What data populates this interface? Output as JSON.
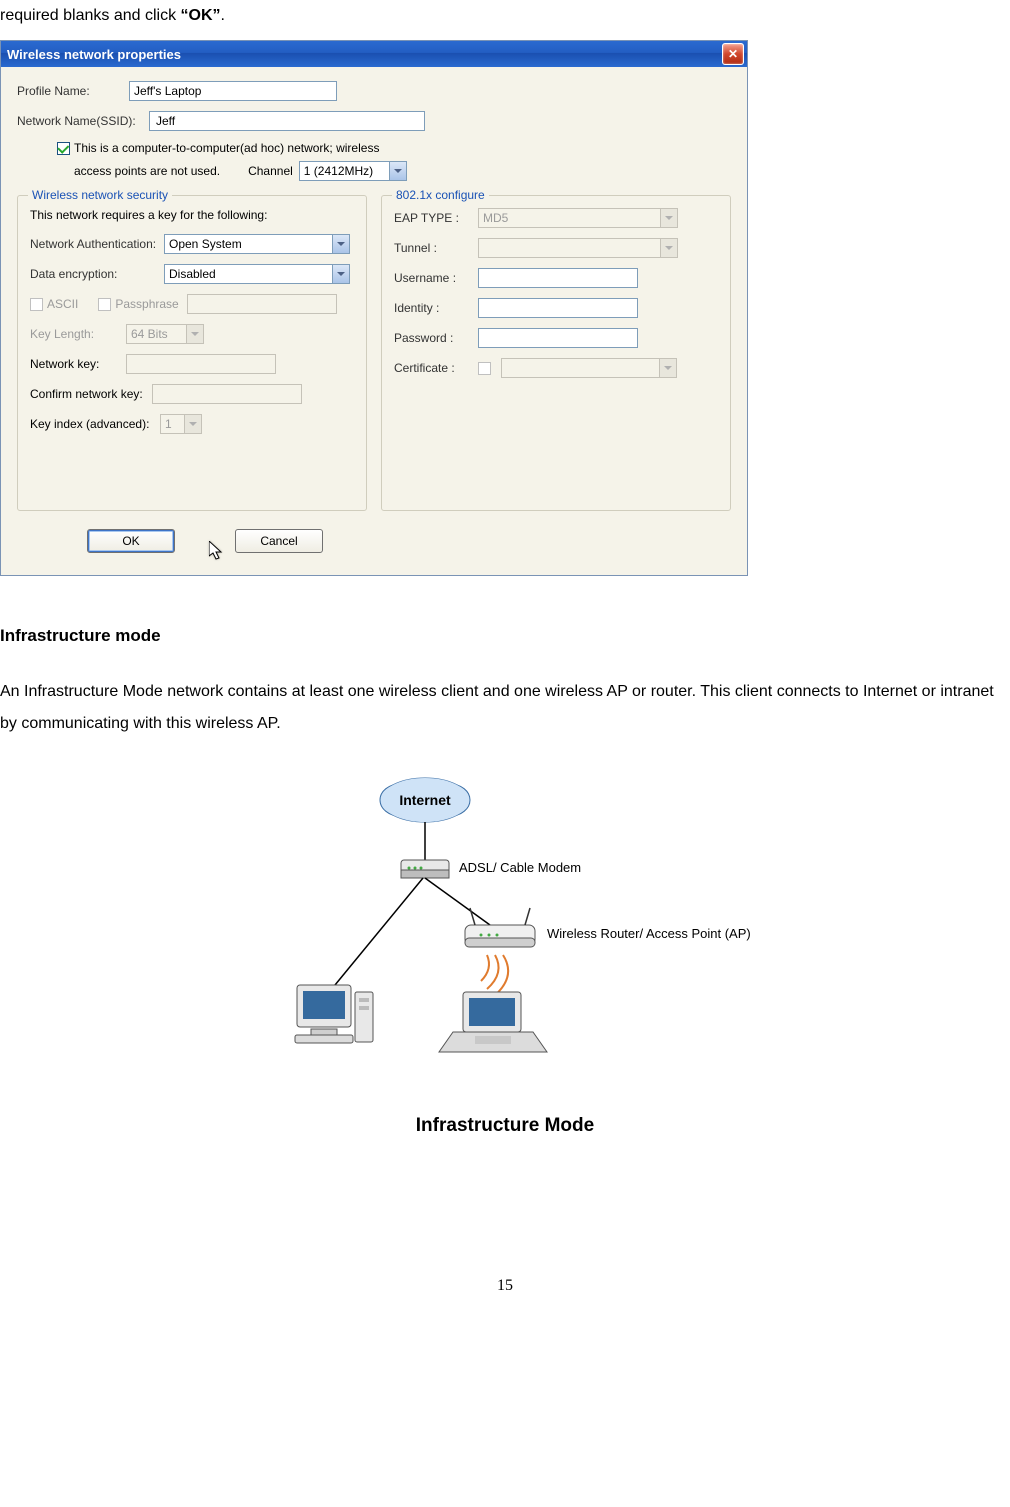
{
  "intro_text_prefix": "required blanks and click ",
  "intro_text_bold": "“OK”",
  "intro_text_suffix": ".",
  "dialog": {
    "title": "Wireless network properties",
    "profile_name_label": "Profile Name:",
    "profile_name_value": "Jeff's Laptop",
    "ssid_label": "Network Name(SSID):",
    "ssid_value": "Jeff",
    "adhoc_text": "This is a computer-to-computer(ad hoc) network; wireless",
    "adhoc_text2_prefix": "access points are not used.",
    "channel_label": "Channel",
    "channel_value": "1 (2412MHz)",
    "security_group": {
      "legend": "Wireless network security",
      "requires_text": "This network requires a key for the following:",
      "auth_label": "Network Authentication:",
      "auth_value": "Open System",
      "encryption_label": "Data encryption:",
      "encryption_value": "Disabled",
      "ascii_label": "ASCII",
      "passphrase_label": "Passphrase",
      "keylength_label": "Key Length:",
      "keylength_value": "64 Bits",
      "netkey_label": "Network key:",
      "confirm_label": "Confirm network key:",
      "keyindex_label": "Key index (advanced):",
      "keyindex_value": "1"
    },
    "dot1x_group": {
      "legend": "802.1x configure",
      "eap_label": "EAP TYPE :",
      "eap_value": "MD5",
      "tunnel_label": "Tunnel :",
      "username_label": "Username :",
      "identity_label": "Identity :",
      "password_label": "Password :",
      "certificate_label": "Certificate :"
    },
    "ok_button": "OK",
    "cancel_button": "Cancel"
  },
  "section_heading": "Infrastructure mode",
  "section_body": "An Infrastructure Mode network contains at least one wireless client and one wireless AP or router. This client connects to Internet or intranet by communicating with this wireless AP.",
  "diagram": {
    "internet_label": "Internet",
    "modem_label": "ADSL/ Cable Modem",
    "router_label": "Wireless Router/ Access Point (AP)",
    "caption": "Infrastructure Mode"
  },
  "page_number": "15"
}
